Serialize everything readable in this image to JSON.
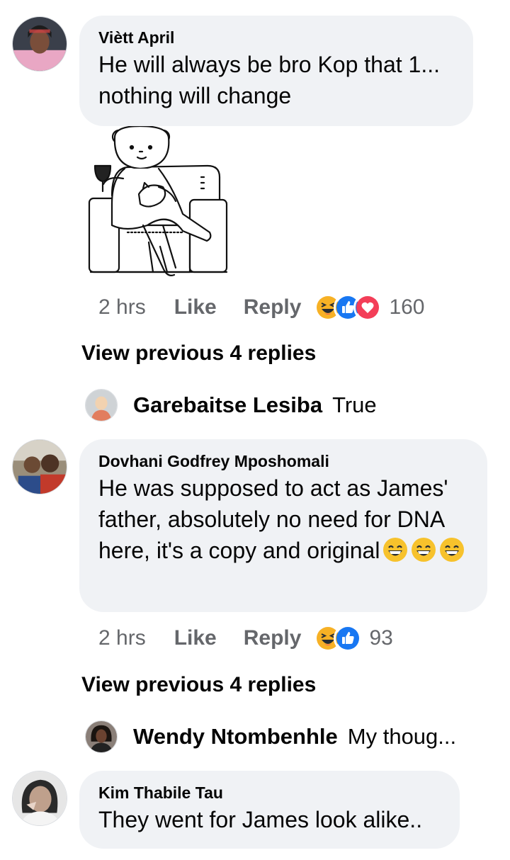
{
  "comments": [
    {
      "author": "Viètt April",
      "text": "He will always be bro Kop that 1... nothing will change",
      "time": "2 hrs",
      "like": "Like",
      "reply": "Reply",
      "reactions": [
        "haha",
        "like",
        "love"
      ],
      "reaction_count": "160",
      "sticker": "bear-in-armchair-sticker",
      "view_previous": "View previous 4 replies",
      "latest_reply": {
        "author": "Garebaitse Lesiba",
        "text": "True"
      }
    },
    {
      "author": "Dovhani Godfrey Mposhomali",
      "text": "He was supposed to act as James' father, absolutely no need for DNA here, it's a copy and original",
      "emojis": [
        "grinning-squinting-face",
        "grinning-squinting-face",
        "grinning-squinting-face"
      ],
      "time": "2 hrs",
      "like": "Like",
      "reply": "Reply",
      "reactions": [
        "haha",
        "like"
      ],
      "reaction_count": "93",
      "view_previous": "View previous 4 replies",
      "latest_reply": {
        "author": "Wendy Ntombenhle",
        "text": "My thoug..."
      }
    },
    {
      "author": "Kim Thabile Tau",
      "text": "They went for James look alike.."
    }
  ],
  "colors": {
    "bubble": "#f0f2f5",
    "meta_text": "#65676b",
    "like_blue": "#1877f2",
    "love_red": "#f33e58",
    "haha_yellow": "#f7b125"
  }
}
